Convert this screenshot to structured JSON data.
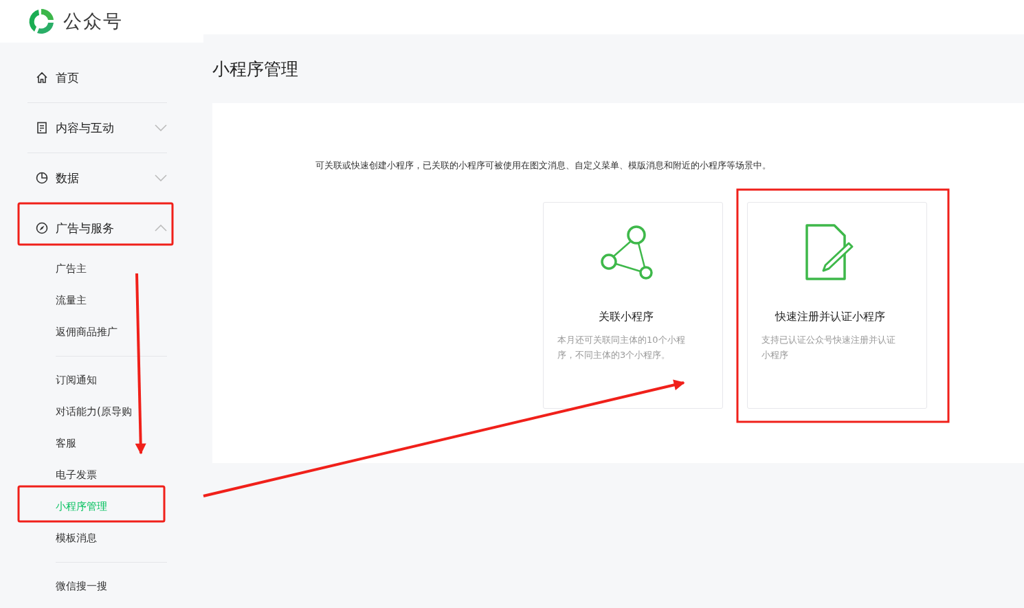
{
  "brand": {
    "name": "公众号"
  },
  "sidebar": {
    "items": [
      {
        "label": "首页",
        "kind": "home"
      },
      {
        "label": "内容与互动",
        "kind": "content",
        "expanded": false
      },
      {
        "label": "数据",
        "kind": "data",
        "expanded": false
      },
      {
        "label": "广告与服务",
        "kind": "services",
        "expanded": true,
        "groups": [
          [
            {
              "label": "广告主",
              "selected": false
            },
            {
              "label": "流量主",
              "selected": false
            },
            {
              "label": "返佣商品推广",
              "selected": false
            }
          ],
          [
            {
              "label": "订阅通知",
              "selected": false
            },
            {
              "label": "对话能力(原导购",
              "selected": false
            },
            {
              "label": "客服",
              "selected": false
            },
            {
              "label": "电子发票",
              "selected": false
            },
            {
              "label": "小程序管理",
              "selected": true
            },
            {
              "label": "模板消息",
              "selected": false
            }
          ],
          [
            {
              "label": "微信搜一搜",
              "selected": false
            }
          ]
        ]
      }
    ]
  },
  "page": {
    "title": "小程序管理",
    "intro": "可关联或快速创建小程序，已关联的小程序可被使用在图文消息、自定义菜单、模版消息和附近的小程序等场景中。",
    "cards": [
      {
        "kind": "link",
        "title": "关联小程序",
        "description": "本月还可关联同主体的10个小程序，不同主体的3个小程序。"
      },
      {
        "kind": "register",
        "title": "快速注册并认证小程序",
        "description": "支持已认证公众号快速注册并认证小程序"
      }
    ]
  }
}
